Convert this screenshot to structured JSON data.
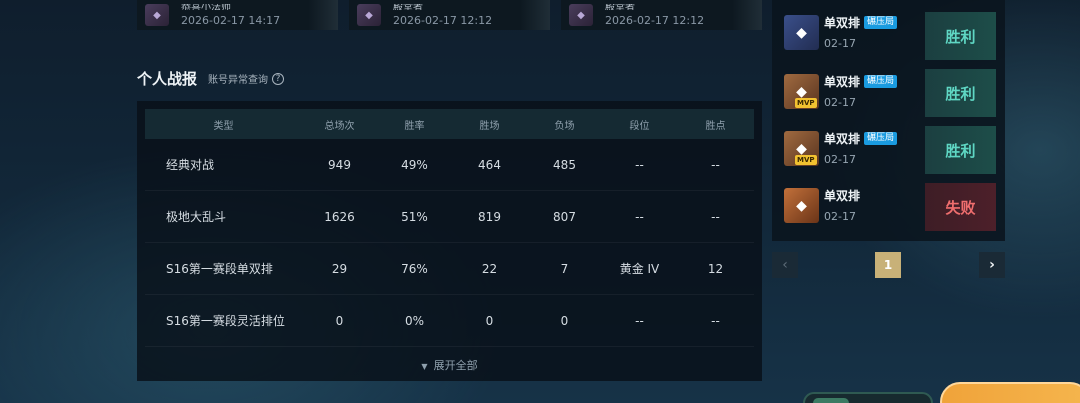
{
  "top_cards": [
    {
      "name": "恭喜小法师",
      "date": "2026-02-17 14:17",
      "thumb_icon": "champion-portrait"
    },
    {
      "name": "殿堂者",
      "date": "2026-02-17 12:12",
      "thumb_icon": "champion-portrait"
    },
    {
      "name": "殿堂者",
      "date": "2026-02-17 12:12",
      "thumb_icon": "champion-portrait"
    }
  ],
  "section": {
    "title": "个人战报",
    "link": "账号异常查询",
    "help_icon": "?"
  },
  "table": {
    "headers": [
      "类型",
      "总场次",
      "胜率",
      "胜场",
      "负场",
      "段位",
      "胜点"
    ],
    "rows": [
      [
        "经典对战",
        "949",
        "49%",
        "464",
        "485",
        "--",
        "--"
      ],
      [
        "极地大乱斗",
        "1626",
        "51%",
        "819",
        "807",
        "--",
        "--"
      ],
      [
        "S16第一赛段单双排",
        "29",
        "76%",
        "22",
        "7",
        "黄金 IV",
        "12"
      ],
      [
        "S16第一赛段灵活排位",
        "0",
        "0%",
        "0",
        "0",
        "--",
        "--"
      ]
    ],
    "expand_label": "展开全部"
  },
  "recent": [
    {
      "mode": "单双排",
      "tag": "碾压局",
      "date": "02-17",
      "result": "胜利",
      "mvp": "",
      "avatar_color": "#3a4f8a"
    },
    {
      "mode": "单双排",
      "tag": "碾压局",
      "date": "02-17",
      "result": "胜利",
      "mvp": "MVP",
      "avatar_color": "#8a5a3a"
    },
    {
      "mode": "单双排",
      "tag": "碾压局",
      "date": "02-17",
      "result": "胜利",
      "mvp": "MVP",
      "avatar_color": "#8a5a3a"
    },
    {
      "mode": "单双排",
      "tag": "",
      "date": "02-17",
      "result": "失败",
      "mvp": "",
      "avatar_color": "#a0562e"
    }
  ],
  "pagination": {
    "prev": "‹",
    "current": "1",
    "next": "›"
  },
  "colors": {
    "win": "#5fd7c4",
    "lose": "#ef6e6e",
    "tag": "#1a9be0",
    "page_active": "#c8b178"
  }
}
